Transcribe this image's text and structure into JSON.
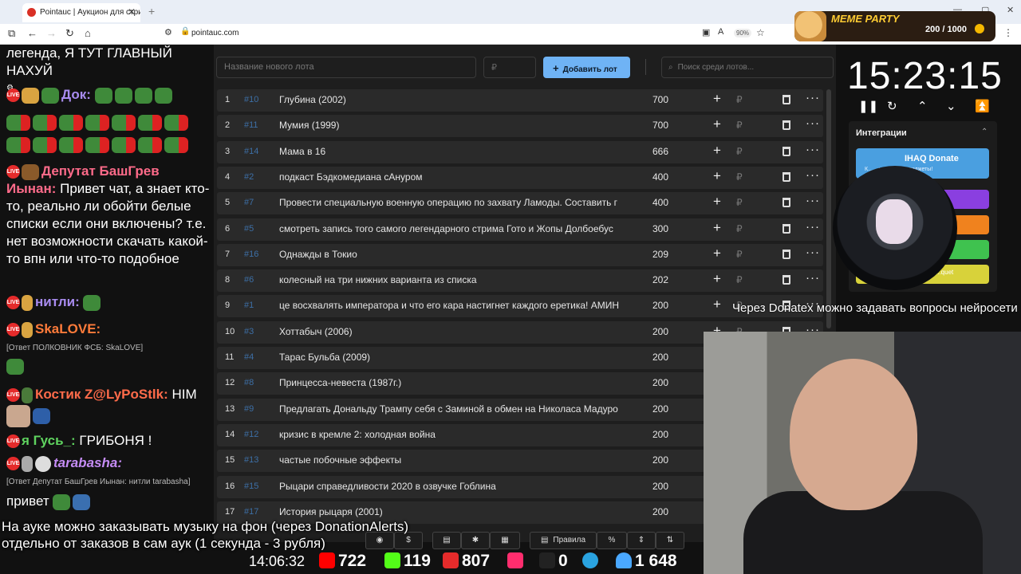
{
  "browser": {
    "tab_title": "Pointauc | Аукцион для стрима",
    "url": "pointauc.com",
    "zoom": "90%"
  },
  "meme_party": {
    "title": "MEME PARTY",
    "count": "200 / 1000"
  },
  "chat": {
    "m0": "легенда, Я ТУТ ГЛАВНЫЙ НАХУЙ",
    "m1_user": "Док:",
    "m2_user": "Депутат БашГрев Иынан:",
    "m2_text": "Привет чат, а знает кто-то, реально ли обойти белые списки если они включены? т.е. нет возможности скачать какой-то впн или что-то подобное",
    "m3_user": "нитли:",
    "m4_user": "SkaLOVE:",
    "m4_reply": "[Ответ ПОЛКОВНИК ФСБ: SkaLOVE]",
    "m5_user": "Костик Z@LyPoStlk:",
    "m5_text": "HIM",
    "m6_user": "я Гусь_:",
    "m6_text": "ГРИБОНЯ !",
    "m7_user": "tarabasha:",
    "m7_reply": "[Ответ Депутат БашГрев Иынан: нитли tarabasha]",
    "m8_text": "привет",
    "live": "LIVE"
  },
  "controls": {
    "lot_placeholder": "Название нового лота",
    "price_placeholder": "₽",
    "add_label": "Добавить лот",
    "search_placeholder": "Поиск среди лотов..."
  },
  "lots": [
    {
      "n": "1",
      "id": "#10",
      "name": "Глубина (2002)",
      "amount": "700"
    },
    {
      "n": "2",
      "id": "#11",
      "name": "Мумия (1999)",
      "amount": "700"
    },
    {
      "n": "3",
      "id": "#14",
      "name": "Мама в 16",
      "amount": "666"
    },
    {
      "n": "4",
      "id": "#2",
      "name": "подкаст Бэдкомедиана сАнуром",
      "amount": "400"
    },
    {
      "n": "5",
      "id": "#7",
      "name": "Провести специальную военную операцию по захвату Ламоды. Составить г",
      "amount": "400"
    },
    {
      "n": "6",
      "id": "#5",
      "name": "смотреть запись того самого легендарного стрима Гото и Жопы Долбоебус",
      "amount": "300"
    },
    {
      "n": "7",
      "id": "#16",
      "name": "Однажды в Токио",
      "amount": "209"
    },
    {
      "n": "8",
      "id": "#6",
      "name": "колесный на три нижних варианта из списка",
      "amount": "202"
    },
    {
      "n": "9",
      "id": "#1",
      "name": "це восхвалять императора и что его кара настигнет каждого еретика! АМИН",
      "amount": "200"
    },
    {
      "n": "10",
      "id": "#3",
      "name": "Хоттабыч (2006)",
      "amount": "200"
    },
    {
      "n": "11",
      "id": "#4",
      "name": "Тарас Бульба (2009)",
      "amount": "200"
    },
    {
      "n": "12",
      "id": "#8",
      "name": "Принцесса-невеста (1987г.)",
      "amount": "200"
    },
    {
      "n": "13",
      "id": "#9",
      "name": "Предлагать Дональду Трампу себя с Заминой в обмен на Николаса Мадуро",
      "amount": "200"
    },
    {
      "n": "14",
      "id": "#12",
      "name": "кризис в кремле 2: холодная война",
      "amount": "200"
    },
    {
      "n": "15",
      "id": "#13",
      "name": "частые побочные эффекты",
      "amount": "200"
    },
    {
      "n": "16",
      "id": "#15",
      "name": "Рыцари справедливости 2020 в озвучке Гоблина",
      "amount": "200"
    },
    {
      "n": "17",
      "id": "#17",
      "name": "История рыцаря (2001)",
      "amount": "200"
    }
  ],
  "row_icons": {
    "plus": "+",
    "rub": "₽",
    "more": "···"
  },
  "bottom_toolbar": {
    "dollar": "$",
    "rules": "Правила",
    "percent": "%"
  },
  "timer": {
    "value": "15:23:15"
  },
  "integrations": {
    "title": "Интеграции",
    "donate_name": "IHAQ Donate",
    "donate_sub": "К... ...никальные виджеты!",
    "bar_label": "...quet"
  },
  "overlays": {
    "question": "Через Donatex можно задавать вопросы нейросети",
    "music_line1": "На ауке можно заказывать музыку на фон (через DonationAlerts)",
    "music_line2": "отдельно от заказов в сам аук (1 секунда - 3 рубля)"
  },
  "stats": {
    "time": "14:06:32",
    "youtube": "722",
    "kick": "119",
    "vk": "807",
    "rutube": "0",
    "viewers": "1 648"
  },
  "colors": {
    "accent": "#6fb3f5",
    "row_bg": "#2a2a2a",
    "panel_bg": "#1e1e1e",
    "fund_id": "#3d6fa6"
  }
}
